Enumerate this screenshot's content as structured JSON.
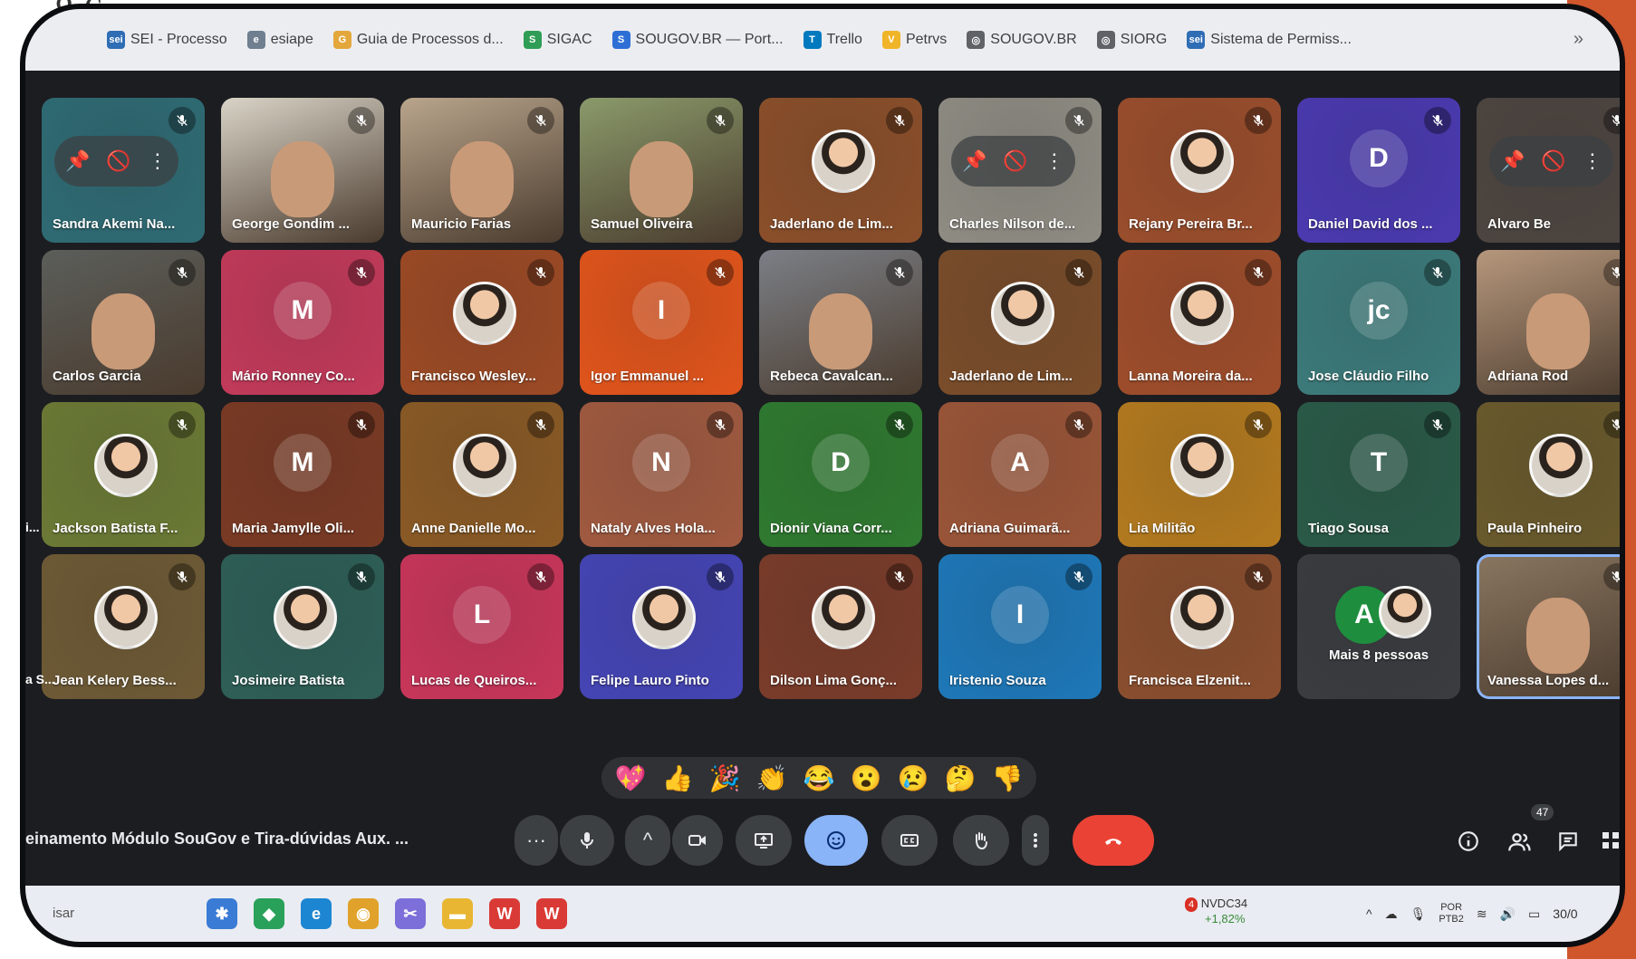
{
  "colors": {
    "orange_band": "#d0562c",
    "meet_bg": "#1c1d21",
    "hangup": "#ea4335",
    "reaction_selected": "#8ab4f8"
  },
  "header_fragment": {
    "text": "g ç"
  },
  "bookmarks": [
    {
      "label": "SEI - Processo",
      "icon": "sei-icon",
      "color": "#2f6db5",
      "glyph": "sei"
    },
    {
      "label": "esiape",
      "icon": "esiape-icon",
      "color": "#6f7f8f",
      "glyph": "e"
    },
    {
      "label": "Guia de Processos d...",
      "icon": "guide-icon",
      "color": "#e3a73b",
      "glyph": "G"
    },
    {
      "label": "SIGAC",
      "icon": "sigac-icon",
      "color": "#2f9d55",
      "glyph": "S"
    },
    {
      "label": "SOUGOV.BR — Port...",
      "icon": "sougov-icon",
      "color": "#2e6fd6",
      "glyph": "S"
    },
    {
      "label": "Trello",
      "icon": "trello-icon",
      "color": "#0079bf",
      "glyph": "T"
    },
    {
      "label": "Petrvs",
      "icon": "petrvs-icon",
      "color": "#f0b429",
      "glyph": "V"
    },
    {
      "label": "SOUGOV.BR",
      "icon": "globe-icon",
      "color": "#5f6368",
      "glyph": "◎"
    },
    {
      "label": "SIORG",
      "icon": "globe-icon",
      "color": "#5f6368",
      "glyph": "◎"
    },
    {
      "label": "Sistema de Permiss...",
      "icon": "sei-icon",
      "color": "#2f6db5",
      "glyph": "sei"
    }
  ],
  "bookmarks_more": "»",
  "participants": [
    {
      "name": "Sandra Akemi Na...",
      "color": "#2f6b74",
      "kind": "overlay",
      "row": 0,
      "col": 0
    },
    {
      "name": "George Gondim ...",
      "color": "#d9d4c7",
      "kind": "video",
      "row": 0,
      "col": 1
    },
    {
      "name": "Mauricio Farias",
      "color": "#b9a58c",
      "kind": "video",
      "row": 0,
      "col": 2
    },
    {
      "name": "Samuel Oliveira",
      "color": "#8a9a6a",
      "kind": "video",
      "row": 0,
      "col": 3
    },
    {
      "name": "Jaderlano de Lim...",
      "color": "#8b4f2a",
      "kind": "photo",
      "row": 0,
      "col": 4
    },
    {
      "name": "Charles Nilson de...",
      "color": "#8f8c83",
      "kind": "overlay",
      "row": 0,
      "col": 5
    },
    {
      "name": "Rejany Pereira Br...",
      "color": "#9a4e2c",
      "kind": "photo",
      "row": 0,
      "col": 6
    },
    {
      "name": "Daniel David dos ...",
      "color": "#4a3ab0",
      "kind": "letter",
      "letter": "D",
      "row": 0,
      "col": 7
    },
    {
      "name": "Alvaro Be",
      "color": "#4d4540",
      "kind": "overlay",
      "row": 0,
      "col": 8
    },
    {
      "name": "Carlos Garcia",
      "color": "#5b5e5a",
      "kind": "video",
      "row": 1,
      "col": 0
    },
    {
      "name": "Mário Ronney Co...",
      "color": "#c23a5a",
      "kind": "letter",
      "letter": "M",
      "row": 1,
      "col": 1
    },
    {
      "name": "Francisco Wesley...",
      "color": "#9c4a25",
      "kind": "photo",
      "row": 1,
      "col": 2
    },
    {
      "name": "Igor Emmanuel ...",
      "color": "#e0541c",
      "kind": "letter",
      "letter": "I",
      "row": 1,
      "col": 3
    },
    {
      "name": "Rebeca Cavalcan...",
      "color": "#7b7f86",
      "kind": "video",
      "row": 1,
      "col": 4
    },
    {
      "name": "Jaderlano de Lim...",
      "color": "#7a4d2a",
      "kind": "photo",
      "row": 1,
      "col": 5
    },
    {
      "name": "Lanna Moreira da...",
      "color": "#9e4d2b",
      "kind": "photo",
      "row": 1,
      "col": 6
    },
    {
      "name": "Jose Cláudio Filho",
      "color": "#3c7a7a",
      "kind": "letter",
      "letter": "jc",
      "row": 1,
      "col": 7
    },
    {
      "name": "Adriana Rod",
      "color": "#b6977c",
      "kind": "video",
      "row": 1,
      "col": 8
    },
    {
      "name": "Jackson Batista F...",
      "color": "#6b7a35",
      "kind": "photo",
      "row": 2,
      "col": 0
    },
    {
      "name": "Maria Jamylle Oli...",
      "color": "#7a3a24",
      "kind": "letter",
      "letter": "M",
      "row": 2,
      "col": 1
    },
    {
      "name": "Anne Danielle Mo...",
      "color": "#8a5a25",
      "kind": "photo",
      "row": 2,
      "col": 2
    },
    {
      "name": "Nataly Alves Hola...",
      "color": "#a05a40",
      "kind": "letter",
      "letter": "N",
      "row": 2,
      "col": 3
    },
    {
      "name": "Dionir Viana Corr...",
      "color": "#2f7a30",
      "kind": "letter",
      "letter": "D",
      "row": 2,
      "col": 4
    },
    {
      "name": "Adriana Guimarã...",
      "color": "#9a5538",
      "kind": "letter",
      "letter": "A",
      "row": 2,
      "col": 5
    },
    {
      "name": "Lia Militão",
      "color": "#b37a1f",
      "kind": "photo",
      "row": 2,
      "col": 6
    },
    {
      "name": "Tiago Sousa",
      "color": "#2a5a48",
      "kind": "letter",
      "letter": "T",
      "row": 2,
      "col": 7
    },
    {
      "name": "Paula Pinheiro",
      "color": "#6a5a2c",
      "kind": "photo",
      "row": 2,
      "col": 8
    },
    {
      "name": "Jean Kelery Bess...",
      "color": "#6e5a35",
      "kind": "photo",
      "row": 3,
      "col": 0
    },
    {
      "name": "Josimeire Batista",
      "color": "#2e5f57",
      "kind": "photo",
      "row": 3,
      "col": 1
    },
    {
      "name": "Lucas de Queiros...",
      "color": "#c8365a",
      "kind": "letter",
      "letter": "L",
      "row": 3,
      "col": 2
    },
    {
      "name": "Felipe Lauro Pinto",
      "color": "#4545b5",
      "kind": "photo",
      "row": 3,
      "col": 3
    },
    {
      "name": "Dilson Lima Gonç...",
      "color": "#7a3c2a",
      "kind": "photo",
      "row": 3,
      "col": 4
    },
    {
      "name": "Iristenio Souza",
      "color": "#1e78b8",
      "kind": "letter",
      "letter": "I",
      "row": 3,
      "col": 5
    },
    {
      "name": "Francisca Elzenit...",
      "color": "#8a4e2e",
      "kind": "photo",
      "row": 3,
      "col": 6
    },
    {
      "name": "Mais 8 pessoas",
      "color": "#3a3c40",
      "kind": "more",
      "letter": "A",
      "row": 3,
      "col": 7
    },
    {
      "name": "Vanessa Lopes d...",
      "color": "#8a7660",
      "kind": "video",
      "row": 3,
      "col": 8
    }
  ],
  "edge_fragments": [
    "i...",
    "a S..."
  ],
  "reactions": [
    "💖",
    "👍",
    "🎉",
    "👏",
    "😂",
    "😮",
    "😢",
    "🤔",
    "👎"
  ],
  "meeting_title": "einamento Módulo SouGov e Tira-dúvidas Aux. ...",
  "controls": {
    "more_label": "···",
    "caret_label": "^",
    "participants_count": "47"
  },
  "taskbar": {
    "search_stub": "isar",
    "apps": [
      {
        "icon": "widgets-icon",
        "color": "#3a7bd5",
        "glyph": "✱"
      },
      {
        "icon": "phone-link-icon",
        "color": "#2aa15a",
        "glyph": "◆"
      },
      {
        "icon": "edge-icon",
        "color": "#1d86d2",
        "glyph": "e"
      },
      {
        "icon": "chrome-icon",
        "color": "#e0a22a",
        "glyph": "◉"
      },
      {
        "icon": "snip-icon",
        "color": "#7c6fd9",
        "glyph": "✂"
      },
      {
        "icon": "folder-icon",
        "color": "#e8b632",
        "glyph": "▬"
      },
      {
        "icon": "wps-icon",
        "color": "#d93a36",
        "glyph": "W"
      },
      {
        "icon": "wps-spreadsheet-icon",
        "color": "#d93a36",
        "glyph": "W"
      }
    ],
    "stock_name": "NVDC34",
    "stock_change": "+1,82%",
    "stock_alert": "4",
    "lang_line1": "POR",
    "lang_line2": "PTB2",
    "clock": "30/0"
  }
}
